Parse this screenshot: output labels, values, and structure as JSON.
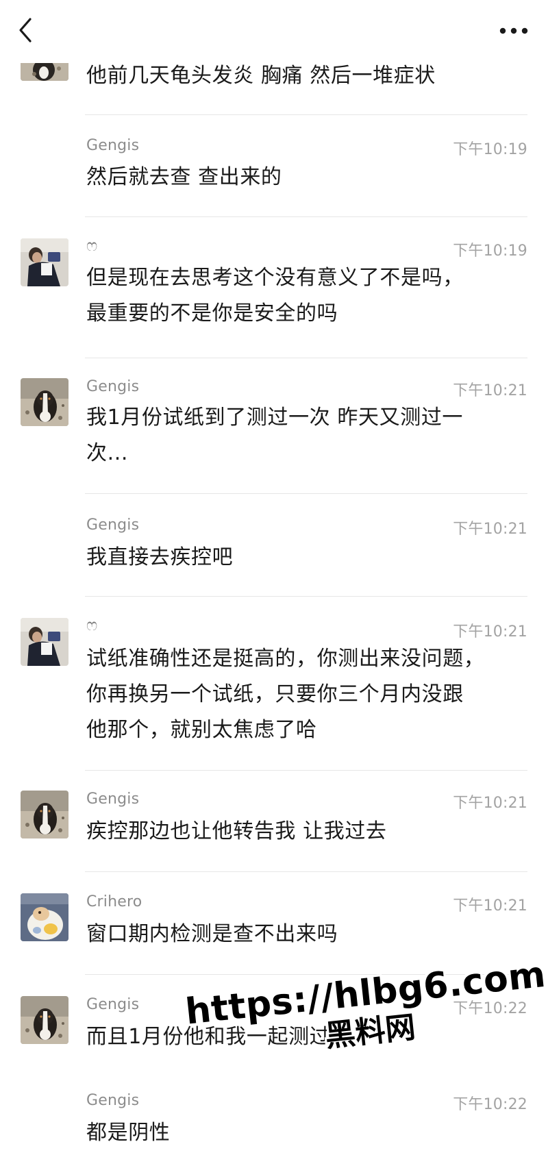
{
  "header": {
    "back_icon": "chevron-left-icon",
    "more_icon": "more-dots-icon"
  },
  "messages": [
    {
      "avatar": "dog",
      "sender": "",
      "time": "",
      "text": "他前几天龟头发炎 胸痛 然后一堆症状"
    },
    {
      "avatar": "",
      "sender": "Gengis",
      "time": "下午10:19",
      "text": "然后就去查 查出来的"
    },
    {
      "avatar": "person",
      "sender": "ෆ",
      "time": "下午10:19",
      "text": "但是现在去思考这个没有意义了不是吗，\n最重要的不是你是安全的吗"
    },
    {
      "avatar": "dog",
      "sender": "Gengis",
      "time": "下午10:21",
      "text": "我1月份试纸到了测过一次 昨天又测过一\n次..."
    },
    {
      "avatar": "",
      "sender": "Gengis",
      "time": "下午10:21",
      "text": "我直接去疾控吧"
    },
    {
      "avatar": "person",
      "sender": "ෆ",
      "time": "下午10:21",
      "text": "试纸准确性还是挺高的，你测出来没问题，\n你再换另一个试纸，只要你三个月内没跟\n他那个，就别太焦虑了哈"
    },
    {
      "avatar": "dog",
      "sender": "Gengis",
      "time": "下午10:21",
      "text": "疾控那边也让他转告我 让我过去"
    },
    {
      "avatar": "cat",
      "sender": "Crihero",
      "time": "下午10:21",
      "text": "窗口期内检测是查不出来吗"
    },
    {
      "avatar": "dog",
      "sender": "Gengis",
      "time": "下午10:22",
      "text": "而且1月份他和我一起测过"
    },
    {
      "avatar": "",
      "sender": "Gengis",
      "time": "下午10:22",
      "text": "都是阴性"
    }
  ],
  "watermark": {
    "url": "https://hlbg6.com",
    "name": "黑料网"
  }
}
